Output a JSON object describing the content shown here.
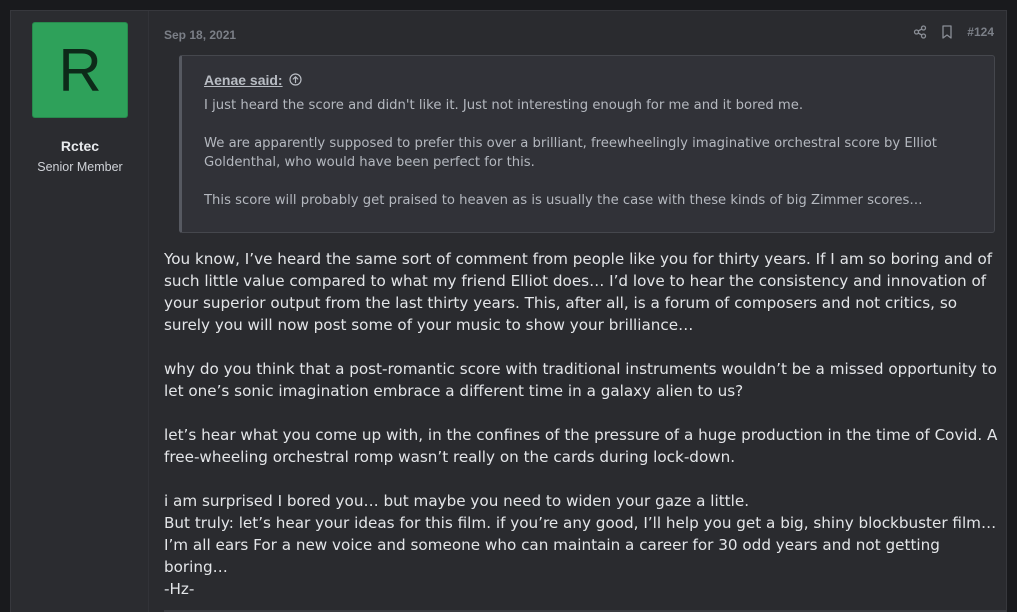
{
  "post": {
    "date": "Sep 18, 2021",
    "number": "#124",
    "user": {
      "avatar_letter": "R",
      "name": "Rctec",
      "title": "Senior Member",
      "avatar_color": "#2ea15a"
    },
    "quote": {
      "author": "Aenae said:",
      "paragraphs": [
        "I just heard the score and didn't like it. Just not interesting enough for me and it bored me.",
        "We are apparently supposed to prefer this over a brilliant, freewheelingly imaginative orchestral score by Elliot Goldenthal, who would have been perfect for this.",
        "This score will probably get praised to heaven as is usually the case with these kinds of big Zimmer scores…"
      ]
    },
    "message": {
      "p1": "You know, I’ve heard the same sort of comment from people like you for thirty years. If I am so boring and of such little value compared to what my friend Elliot does… I’d love to hear the consistency and innovation of your superior output from the last thirty years. This, after all, is a forum of composers and not critics, so surely you will now post some of your music to show your brilliance…",
      "p2": "why do you think that a post-romantic score with traditional instruments wouldn’t be a missed opportunity to let one’s sonic imagination embrace a different time in a galaxy alien to us?",
      "p3": "let’s hear what you come up with, in the confines of the pressure of a huge production in the time of Covid. A free-wheeling orchestral romp wasn’t really on the cards during lock-down.",
      "p4a": "i am surprised I bored you… but maybe you need to widen your gaze a little.",
      "p4b": "But truly: let’s hear your ideas for this film. if you’re any good, I’ll help you get a big, shiny blockbuster film…I’m all ears For a new voice and someone who can maintain a career for 30 odd years and not getting boring…",
      "p4c": "-Hz-"
    },
    "icons": {
      "share": "share-icon",
      "bookmark": "bookmark-icon",
      "quote_expand": "arrow-up-circle-icon"
    }
  }
}
